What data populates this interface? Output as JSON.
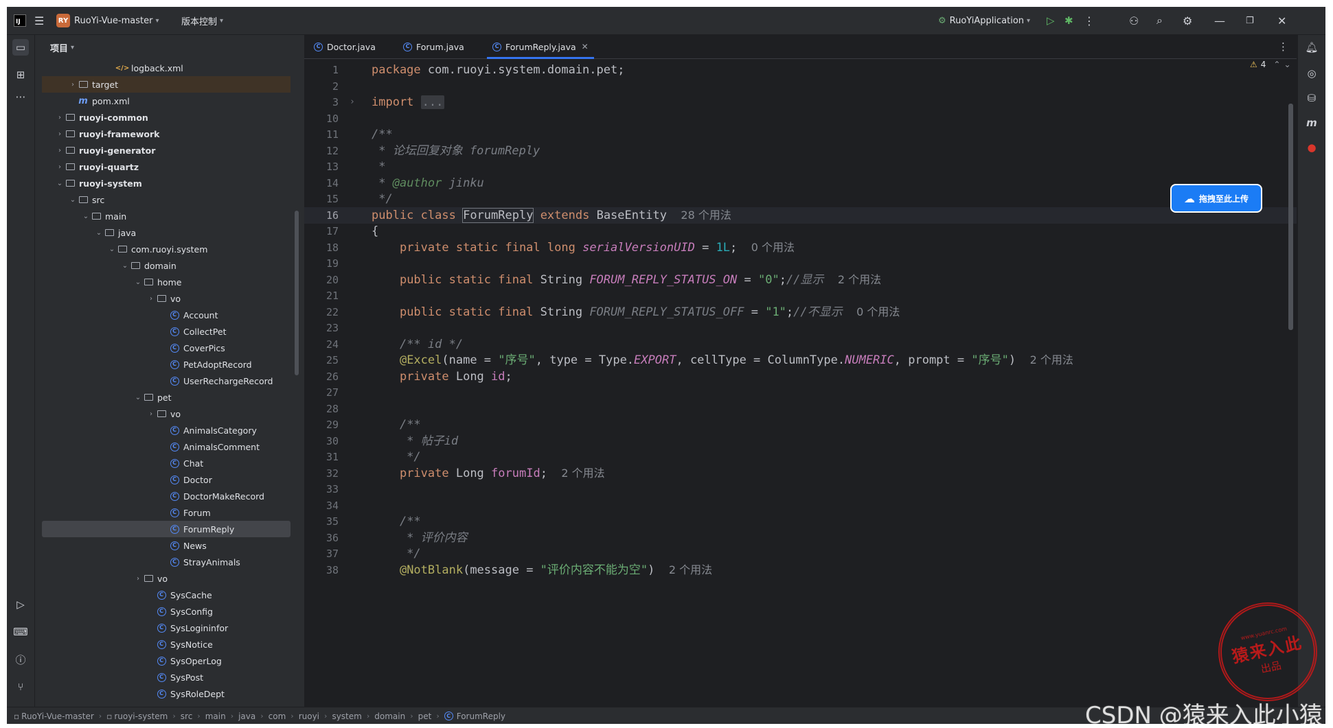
{
  "titlebar": {
    "project_badge": "RY",
    "project_name": "RuoYi-Vue-master",
    "vcs": "版本控制",
    "run_config": "RuoYiApplication"
  },
  "project_panel": {
    "title": "项目",
    "tree": [
      {
        "label": "logback.xml",
        "icon": "xml-file-icon",
        "depth": 5,
        "arrow": ""
      },
      {
        "label": "target",
        "icon": "folder-icon",
        "depth": 2,
        "arrow": "›",
        "hl": true
      },
      {
        "label": "pom.xml",
        "icon": "maven-file-icon",
        "depth": 2,
        "arrow": ""
      },
      {
        "label": "ruoyi-common",
        "icon": "module-folder-icon",
        "depth": 1,
        "arrow": "›",
        "bold": true
      },
      {
        "label": "ruoyi-framework",
        "icon": "module-folder-icon",
        "depth": 1,
        "arrow": "›",
        "bold": true
      },
      {
        "label": "ruoyi-generator",
        "icon": "module-folder-icon",
        "depth": 1,
        "arrow": "›",
        "bold": true
      },
      {
        "label": "ruoyi-quartz",
        "icon": "module-folder-icon",
        "depth": 1,
        "arrow": "›",
        "bold": true
      },
      {
        "label": "ruoyi-system",
        "icon": "module-folder-icon",
        "depth": 1,
        "arrow": "⌄",
        "bold": true
      },
      {
        "label": "src",
        "icon": "folder-icon",
        "depth": 2,
        "arrow": "⌄"
      },
      {
        "label": "main",
        "icon": "folder-icon",
        "depth": 3,
        "arrow": "⌄"
      },
      {
        "label": "java",
        "icon": "folder-icon",
        "depth": 4,
        "arrow": "⌄"
      },
      {
        "label": "com.ruoyi.system",
        "icon": "package-icon",
        "depth": 5,
        "arrow": "⌄"
      },
      {
        "label": "domain",
        "icon": "package-icon",
        "depth": 6,
        "arrow": "⌄"
      },
      {
        "label": "home",
        "icon": "package-icon",
        "depth": 7,
        "arrow": "⌄"
      },
      {
        "label": "vo",
        "icon": "package-icon",
        "depth": 8,
        "arrow": "›"
      },
      {
        "label": "Account",
        "icon": "class-icon",
        "depth": 9,
        "arrow": ""
      },
      {
        "label": "CollectPet",
        "icon": "class-icon",
        "depth": 9,
        "arrow": ""
      },
      {
        "label": "CoverPics",
        "icon": "class-icon",
        "depth": 9,
        "arrow": ""
      },
      {
        "label": "PetAdoptRecord",
        "icon": "class-icon",
        "depth": 9,
        "arrow": ""
      },
      {
        "label": "UserRechargeRecord",
        "icon": "class-icon",
        "depth": 9,
        "arrow": ""
      },
      {
        "label": "pet",
        "icon": "package-icon",
        "depth": 7,
        "arrow": "⌄"
      },
      {
        "label": "vo",
        "icon": "package-icon",
        "depth": 8,
        "arrow": "›"
      },
      {
        "label": "AnimalsCategory",
        "icon": "class-icon",
        "depth": 9,
        "arrow": ""
      },
      {
        "label": "AnimalsComment",
        "icon": "class-icon",
        "depth": 9,
        "arrow": ""
      },
      {
        "label": "Chat",
        "icon": "class-icon",
        "depth": 9,
        "arrow": ""
      },
      {
        "label": "Doctor",
        "icon": "class-icon",
        "depth": 9,
        "arrow": ""
      },
      {
        "label": "DoctorMakeRecord",
        "icon": "class-icon",
        "depth": 9,
        "arrow": ""
      },
      {
        "label": "Forum",
        "icon": "class-icon",
        "depth": 9,
        "arrow": ""
      },
      {
        "label": "ForumReply",
        "icon": "class-icon",
        "depth": 9,
        "arrow": "",
        "selected": true
      },
      {
        "label": "News",
        "icon": "class-icon",
        "depth": 9,
        "arrow": ""
      },
      {
        "label": "StrayAnimals",
        "icon": "class-icon",
        "depth": 9,
        "arrow": ""
      },
      {
        "label": "vo",
        "icon": "package-icon",
        "depth": 7,
        "arrow": "›"
      },
      {
        "label": "SysCache",
        "icon": "class-icon",
        "depth": 8,
        "arrow": ""
      },
      {
        "label": "SysConfig",
        "icon": "class-icon",
        "depth": 8,
        "arrow": ""
      },
      {
        "label": "SysLogininfor",
        "icon": "class-icon",
        "depth": 8,
        "arrow": ""
      },
      {
        "label": "SysNotice",
        "icon": "class-icon",
        "depth": 8,
        "arrow": ""
      },
      {
        "label": "SysOperLog",
        "icon": "class-icon",
        "depth": 8,
        "arrow": ""
      },
      {
        "label": "SysPost",
        "icon": "class-icon",
        "depth": 8,
        "arrow": ""
      },
      {
        "label": "SysRoleDept",
        "icon": "class-icon",
        "depth": 8,
        "arrow": ""
      }
    ]
  },
  "tabs": [
    {
      "label": "Doctor.java"
    },
    {
      "label": "Forum.java"
    },
    {
      "label": "ForumReply.java",
      "active": true
    }
  ],
  "editor": {
    "warning_count": "4",
    "current_line": 16,
    "lines": [
      {
        "n": "1",
        "html": "<span class=\"kw\">package</span> com.ruoyi.system.domain.pet;"
      },
      {
        "n": "2",
        "html": ""
      },
      {
        "n": "3",
        "html": "<span class=\"kw\">import</span> <span class=\"fold\">...</span>",
        "fold": true
      },
      {
        "n": "10",
        "html": ""
      },
      {
        "n": "11",
        "html": "<span class=\"cm\">/**</span>"
      },
      {
        "n": "12",
        "html": "<span class=\"cm\"> * 论坛回复对象 forumReply</span>"
      },
      {
        "n": "13",
        "html": "<span class=\"cm\"> *</span>"
      },
      {
        "n": "14",
        "html": "<span class=\"cm\"> * </span><span class=\"tag\">@author</span><span class=\"cm\"> jinku</span>"
      },
      {
        "n": "15",
        "html": "<span class=\"cm\"> */</span>"
      },
      {
        "n": "16",
        "html": "<span class=\"kw\">public class</span> <span class=\"caretbox\">ForumReply</span> <span class=\"kw\">extends</span> BaseEntity  <span class=\"hint\">28 个用法</span>"
      },
      {
        "n": "17",
        "html": "{"
      },
      {
        "n": "18",
        "html": "    <span class=\"kw\">private static final long</span> <span class=\"fldi\">serialVersionUID</span> = <span class=\"num\">1L</span>;  <span class=\"hint\">0 个用法</span>"
      },
      {
        "n": "19",
        "html": ""
      },
      {
        "n": "20",
        "html": "    <span class=\"kw\">public static final</span> String <span class=\"fldi\">FORUM_REPLY_STATUS_ON</span> = <span class=\"st\">\"0\"</span>;<span class=\"cm\">//显示</span>  <span class=\"hint\">2 个用法</span>"
      },
      {
        "n": "21",
        "html": ""
      },
      {
        "n": "22",
        "html": "    <span class=\"kw\">public static final</span> String <span class=\"cm\">FORUM_REPLY_STATUS_OFF</span> = <span class=\"st\">\"1\"</span>;<span class=\"cm\">//不显示</span>  <span class=\"hint\">0 个用法</span>"
      },
      {
        "n": "23",
        "html": ""
      },
      {
        "n": "24",
        "html": "    <span class=\"cm\">/** id */</span>"
      },
      {
        "n": "25",
        "html": "    <span class=\"ann\">@Excel</span>(name = <span class=\"st\">\"序号\"</span>, type = Type.<span class=\"fldi\">EXPORT</span>, cellType = ColumnType.<span class=\"fldi\">NUMERIC</span>, prompt = <span class=\"st\">\"序号\"</span>)  <span class=\"hint\">2 个用法</span>"
      },
      {
        "n": "26",
        "html": "    <span class=\"kw\">private</span> Long <span class=\"fld\">id</span>;"
      },
      {
        "n": "27",
        "html": ""
      },
      {
        "n": "28",
        "html": ""
      },
      {
        "n": "29",
        "html": "    <span class=\"cm\">/**</span>"
      },
      {
        "n": "30",
        "html": "<span class=\"cm\">     * 帖子id</span>"
      },
      {
        "n": "31",
        "html": "<span class=\"cm\">     */</span>"
      },
      {
        "n": "32",
        "html": "    <span class=\"kw\">private</span> Long <span class=\"fld\">forumId</span>;  <span class=\"hint\">2 个用法</span>"
      },
      {
        "n": "33",
        "html": ""
      },
      {
        "n": "34",
        "html": ""
      },
      {
        "n": "35",
        "html": "    <span class=\"cm\">/**</span>"
      },
      {
        "n": "36",
        "html": "<span class=\"cm\">     * 评价内容</span>"
      },
      {
        "n": "37",
        "html": "<span class=\"cm\">     */</span>"
      },
      {
        "n": "38",
        "html": "    <span class=\"ann\">@NotBlank</span>(message = <span class=\"st\">\"评价内容不能为空\"</span>)  <span class=\"hint\">2 个用法</span>"
      }
    ]
  },
  "breadcrumbs": [
    "RuoYi-Vue-master",
    "ruoyi-system",
    "src",
    "main",
    "java",
    "com",
    "ruoyi",
    "system",
    "domain",
    "pet",
    "ForumReply"
  ],
  "overlays": {
    "upload_button": "拖拽至此上传",
    "stamp_big": "猿来入此",
    "stamp_small": "出品",
    "stamp_url": "www.yuanrc.com",
    "watermark": "CSDN @猿来入此小猿"
  },
  "colors": {
    "bg": "#1e1f22",
    "panel": "#2b2d30",
    "keyword": "#cf8e6d",
    "string": "#6aab73",
    "comment": "#7a7e85",
    "field": "#c77dbb",
    "accent": "#3574f0"
  }
}
